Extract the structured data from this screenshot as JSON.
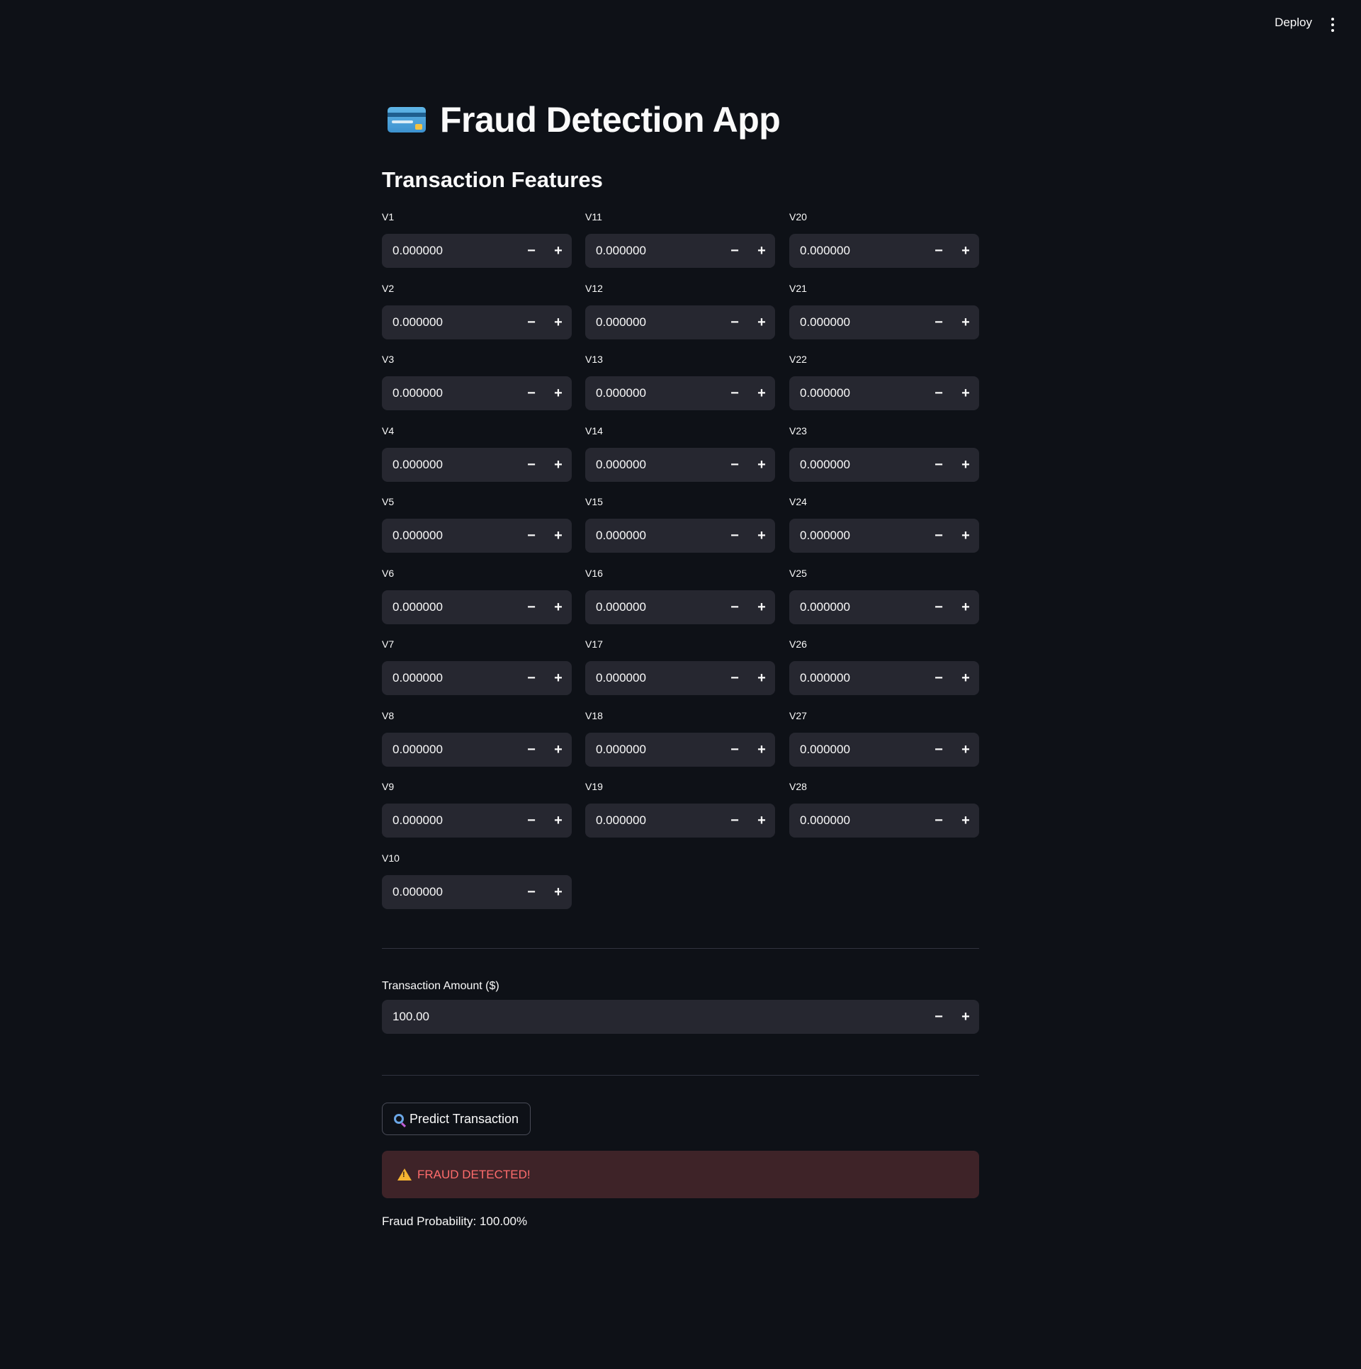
{
  "header": {
    "deploy_label": "Deploy",
    "menu_icon": "kebab-menu-icon"
  },
  "page": {
    "title": "Fraud Detection App",
    "title_icon": "credit-card-icon",
    "subtitle": "Transaction Features"
  },
  "features": [
    {
      "label": "V1",
      "value": "0.000000"
    },
    {
      "label": "V2",
      "value": "0.000000"
    },
    {
      "label": "V3",
      "value": "0.000000"
    },
    {
      "label": "V4",
      "value": "0.000000"
    },
    {
      "label": "V5",
      "value": "0.000000"
    },
    {
      "label": "V6",
      "value": "0.000000"
    },
    {
      "label": "V7",
      "value": "0.000000"
    },
    {
      "label": "V8",
      "value": "0.000000"
    },
    {
      "label": "V9",
      "value": "0.000000"
    },
    {
      "label": "V10",
      "value": "0.000000"
    },
    {
      "label": "V11",
      "value": "0.000000"
    },
    {
      "label": "V12",
      "value": "0.000000"
    },
    {
      "label": "V13",
      "value": "0.000000"
    },
    {
      "label": "V14",
      "value": "0.000000"
    },
    {
      "label": "V15",
      "value": "0.000000"
    },
    {
      "label": "V16",
      "value": "0.000000"
    },
    {
      "label": "V17",
      "value": "0.000000"
    },
    {
      "label": "V18",
      "value": "0.000000"
    },
    {
      "label": "V19",
      "value": "0.000000"
    },
    {
      "label": "V20",
      "value": "0.000000"
    },
    {
      "label": "V21",
      "value": "0.000000"
    },
    {
      "label": "V22",
      "value": "0.000000"
    },
    {
      "label": "V23",
      "value": "0.000000"
    },
    {
      "label": "V24",
      "value": "0.000000"
    },
    {
      "label": "V25",
      "value": "0.000000"
    },
    {
      "label": "V26",
      "value": "0.000000"
    },
    {
      "label": "V27",
      "value": "0.000000"
    },
    {
      "label": "V28",
      "value": "0.000000"
    }
  ],
  "stepper": {
    "minus": "−",
    "plus": "+"
  },
  "amount": {
    "label": "Transaction Amount ($)",
    "value": "100.00"
  },
  "predict_button": {
    "label": "Predict Transaction",
    "icon": "magnifying-glass-icon"
  },
  "result": {
    "alert_text": "FRAUD DETECTED!",
    "alert_icon": "warning-icon",
    "probability_text": "Fraud Probability: 100.00%"
  },
  "colors": {
    "background": "#0e1117",
    "input_bg": "#262730",
    "alert_bg": "#3e2328",
    "alert_text": "#ff6c6c"
  }
}
